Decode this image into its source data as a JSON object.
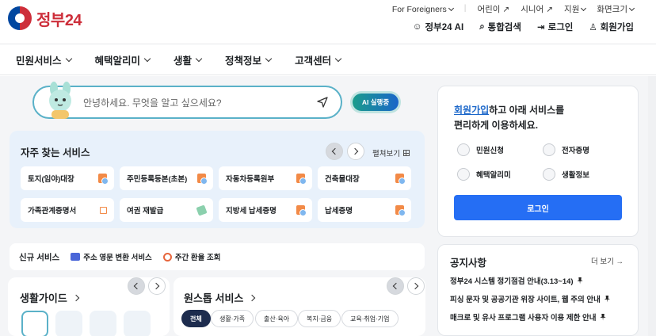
{
  "brand": {
    "logo_text": "정부",
    "logo_num": "24"
  },
  "util_nav": [
    {
      "label": "For Foreigners",
      "icon": "chevron-down-icon"
    },
    {
      "label": "어린이",
      "icon": "external-link-icon"
    },
    {
      "label": "시니어",
      "icon": "external-link-icon"
    },
    {
      "label": "지원",
      "icon": "chevron-down-icon"
    },
    {
      "label": "화면크기",
      "icon": "chevron-down-icon"
    }
  ],
  "top_actions": [
    {
      "label": "정부24 AI",
      "icon": "ai-bot-icon"
    },
    {
      "label": "통합검색",
      "icon": "search-icon"
    },
    {
      "label": "로그인",
      "icon": "login-icon"
    },
    {
      "label": "회원가입",
      "icon": "user-add-icon"
    }
  ],
  "gnb": [
    "민원서비스",
    "혜택알리미",
    "생활",
    "정책정보",
    "고객센터"
  ],
  "search": {
    "placeholder": "안녕하세요. 무엇을 알고 싶으세요?",
    "ai_button": "AI 실행중"
  },
  "frequent": {
    "title": "자주 찾는 서비스",
    "expand_label": "펼쳐보기",
    "items": [
      {
        "label": "토지(임야)대장",
        "icon": "document-icon"
      },
      {
        "label": "주민등록등본(초본)",
        "icon": "document-icon"
      },
      {
        "label": "자동차등록원부",
        "icon": "document-icon"
      },
      {
        "label": "건축물대장",
        "icon": "document-icon"
      },
      {
        "label": "가족관계증명서",
        "icon": "external-link-icon"
      },
      {
        "label": "여권 재발급",
        "icon": "pen-icon"
      },
      {
        "label": "지방세 납세증명",
        "icon": "document-icon"
      },
      {
        "label": "납세증명",
        "icon": "document-icon"
      }
    ]
  },
  "new_services": {
    "title": "신규 서비스",
    "items": [
      {
        "label": "주소 영문 변환 서비스",
        "icon": "box-icon"
      },
      {
        "label": "주간 환율 조회",
        "icon": "exchange-icon"
      }
    ]
  },
  "guide": {
    "title": "생활가이드"
  },
  "onestop": {
    "title": "원스톱 서비스",
    "filters": [
      "전체",
      "생활·가족",
      "출산·육아",
      "복지·금융",
      "교육·취업·기업"
    ]
  },
  "login_box": {
    "welcome_link": "회원가입",
    "welcome_rest": "하고 아래 서비스를",
    "welcome_line2": "편리하게 이용하세요.",
    "services": [
      {
        "label": "민원신청",
        "icon": "mail-icon"
      },
      {
        "label": "전자증명",
        "icon": "certificate-icon"
      },
      {
        "label": "혜택알리미",
        "icon": "gift-icon"
      },
      {
        "label": "생활정보",
        "icon": "info-icon"
      }
    ],
    "login_button": "로그인"
  },
  "notices": {
    "title": "공지사항",
    "more": "더 보기 →",
    "items": [
      "정부24 시스템 정기점검 안내(3.13~14)",
      "피싱 문자 및 공공기관 위장 사이트, 웹 주의 안내",
      "매크로 및 유사 프로그램 사용자 이용 제한 안내"
    ]
  },
  "colors": {
    "primary": "#256ef4",
    "accent_teal": "#5ab1c8",
    "brand_red": "#cd2e3a",
    "nav_dark": "#1d2c4e"
  }
}
